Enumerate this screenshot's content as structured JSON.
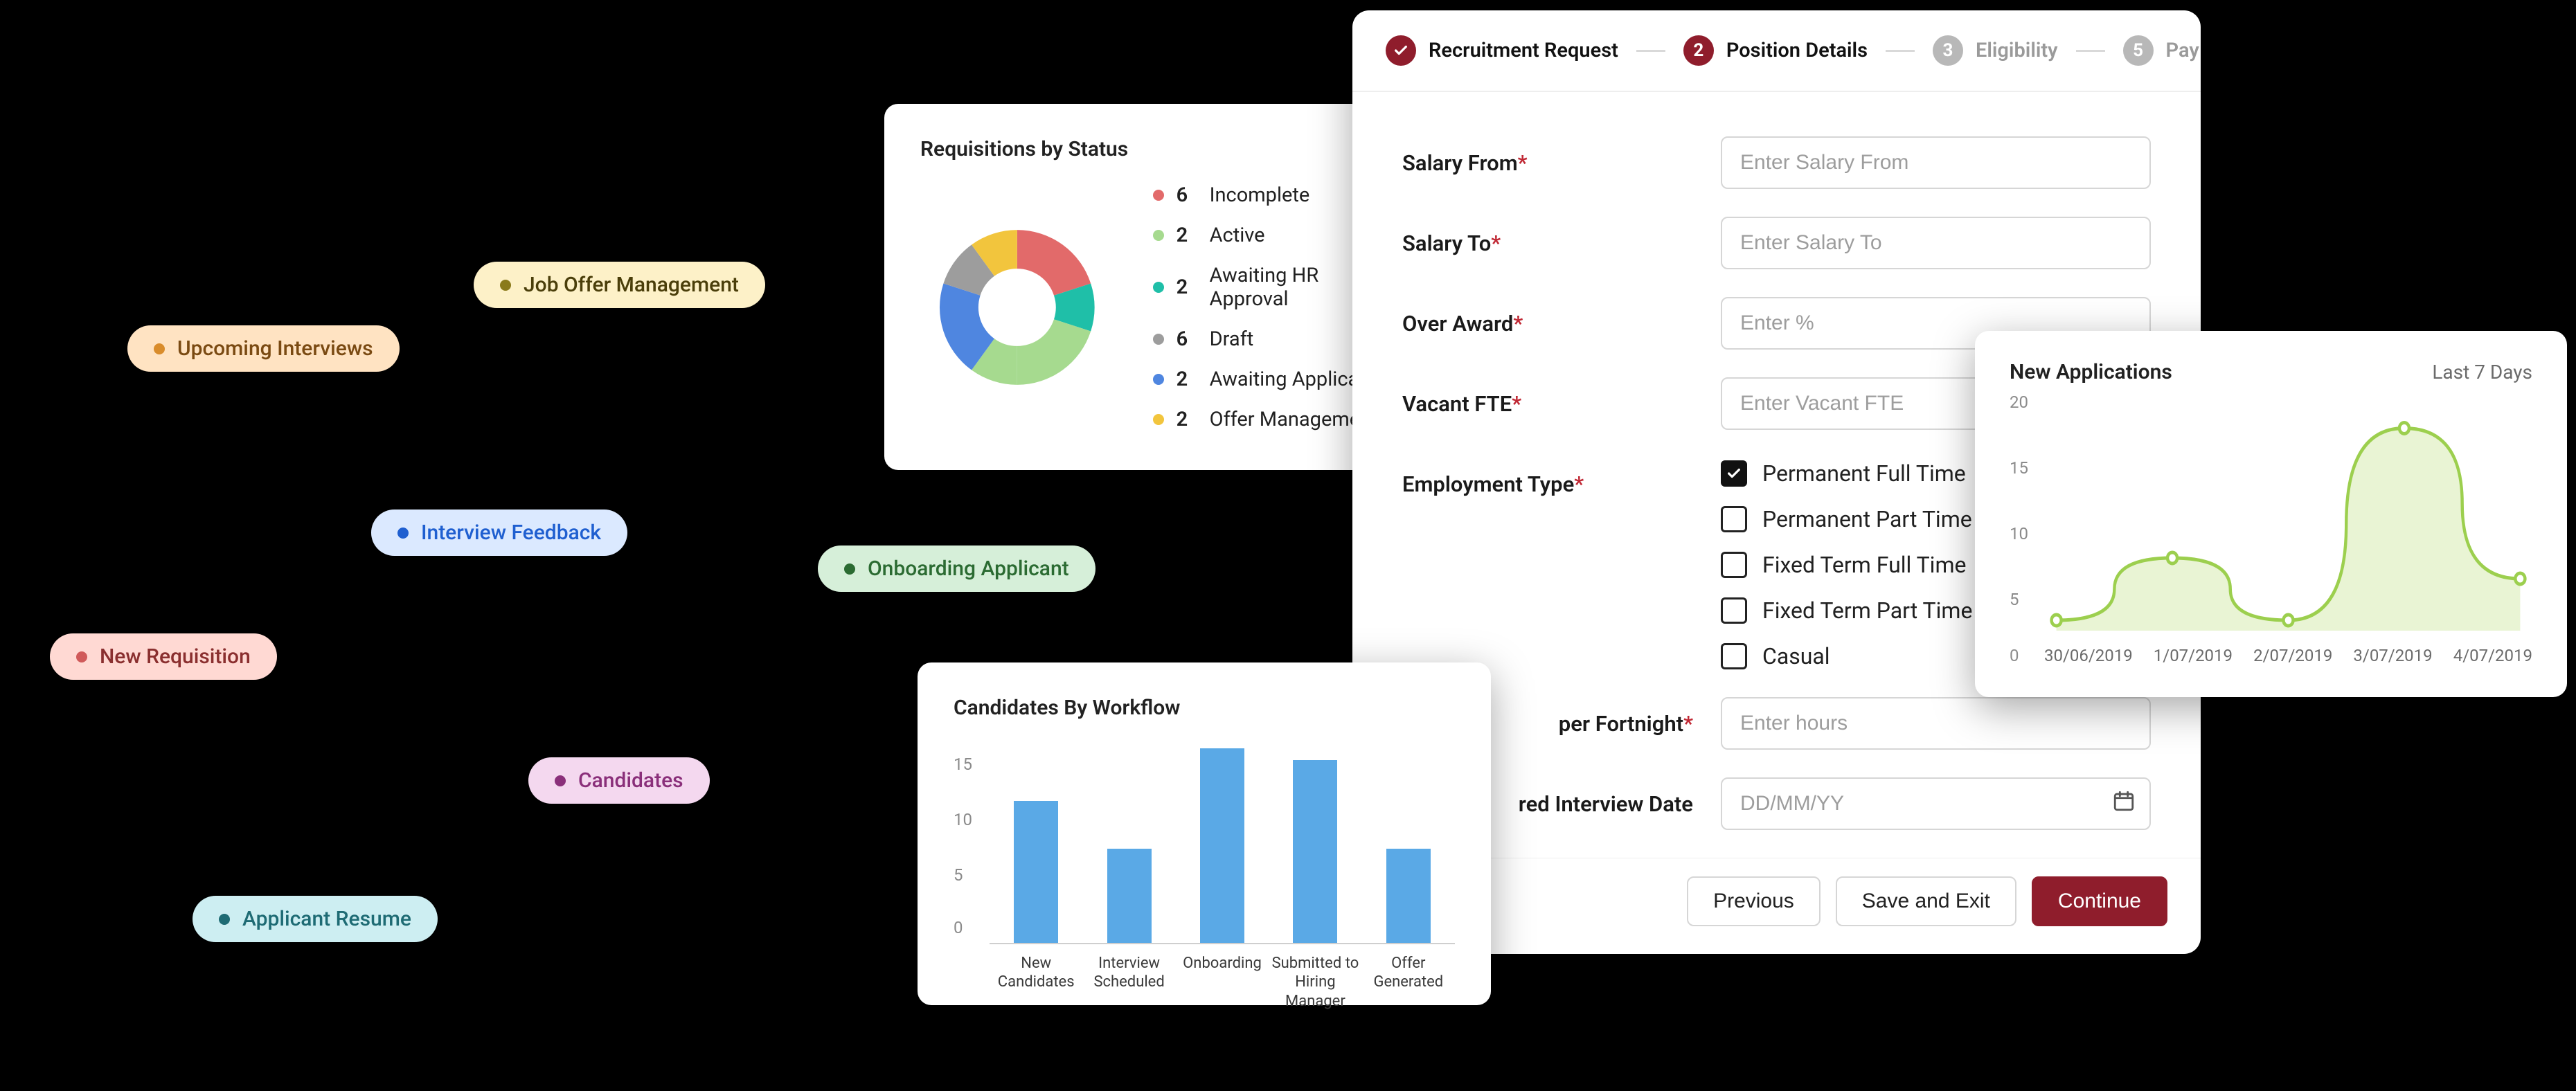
{
  "pills": {
    "job_offer_mgmt": "Job Offer Management",
    "upcoming_interviews": "Upcoming Interviews",
    "interview_feedback": "Interview Feedback",
    "onboarding_applicant": "Onboarding Applicant",
    "new_requisition": "New Requisition",
    "candidates": "Candidates",
    "applicant_resume": "Applicant Resume"
  },
  "donut": {
    "title": "Requisitions by Status",
    "items": [
      {
        "count": "6",
        "label": "Incomplete",
        "color": "#e26a6a"
      },
      {
        "count": "2",
        "label": "Active",
        "color": "#a6da8f"
      },
      {
        "count": "2",
        "label": "Awaiting HR Approval",
        "color": "#1fbfa8"
      },
      {
        "count": "6",
        "label": "Draft",
        "color": "#9d9d9d"
      },
      {
        "count": "2",
        "label": "Awaiting Applicant",
        "color": "#4f86e0"
      },
      {
        "count": "2",
        "label": "Offer Management",
        "color": "#f2c53d"
      }
    ]
  },
  "bar": {
    "title": "Candidates By Workflow"
  },
  "chart_data": [
    {
      "id": "requisitions_by_status",
      "type": "pie",
      "title": "Requisitions by Status",
      "categories": [
        "Incomplete",
        "Active",
        "Awaiting HR Approval",
        "Draft",
        "Awaiting Applicant",
        "Offer Management"
      ],
      "values": [
        6,
        2,
        2,
        6,
        2,
        2
      ],
      "colors": [
        "#e26a6a",
        "#a6da8f",
        "#1fbfa8",
        "#9d9d9d",
        "#4f86e0",
        "#f2c53d"
      ]
    },
    {
      "id": "candidates_by_workflow",
      "type": "bar",
      "title": "Candidates By Workflow",
      "categories": [
        "New Candidates",
        "Interview Scheduled",
        "Onboarding",
        "Submitted to Hiring Manager",
        "Offer Generated"
      ],
      "values": [
        12,
        8,
        16.5,
        15.5,
        8
      ],
      "ylim": [
        0,
        17
      ],
      "yticks": [
        0,
        5,
        10,
        15
      ],
      "color": "#5aa9e6"
    },
    {
      "id": "new_applications",
      "type": "line",
      "title": "New Applications",
      "subtitle": "Last 7 Days",
      "x": [
        "30/06/2019",
        "1/07/2019",
        "2/07/2019",
        "3/07/2019",
        "4/07/2019"
      ],
      "values": [
        1,
        7,
        1,
        19.5,
        5
      ],
      "ylim": [
        0,
        22
      ],
      "yticks": [
        0,
        5,
        10,
        15,
        20
      ],
      "color": "#9ccf4e"
    }
  ],
  "form": {
    "steps": {
      "s1": "Recruitment Request",
      "s2_num": "2",
      "s2": "Position Details",
      "s3_num": "3",
      "s3": "Eligibility",
      "s4_num": "5",
      "s4": "Pay Details"
    },
    "labels": {
      "salary_from": "Salary From",
      "salary_to": "Salary To",
      "over_award": "Over Award",
      "vacant_fte": "Vacant FTE",
      "employment_type": "Employment Type",
      "per_fortnight": "per Fortnight",
      "interview_date": "red Interview Date"
    },
    "placeholders": {
      "salary_from": "Enter Salary From",
      "salary_to": "Enter Salary To",
      "over_award": "Enter %",
      "vacant_fte": "Enter Vacant FTE",
      "per_fortnight": "Enter hours",
      "interview_date": "DD/MM/YY"
    },
    "employment_options": {
      "o1": "Permanent Full Time",
      "o2": "Permanent Part Time",
      "o3": "Fixed Term Full Time",
      "o4": "Fixed Term Part Time",
      "o5": "Casual"
    },
    "buttons": {
      "previous": "Previous",
      "save_exit": "Save and Exit",
      "continue": "Continue"
    }
  },
  "line": {
    "title": "New Applications",
    "range": "Last 7 Days"
  }
}
